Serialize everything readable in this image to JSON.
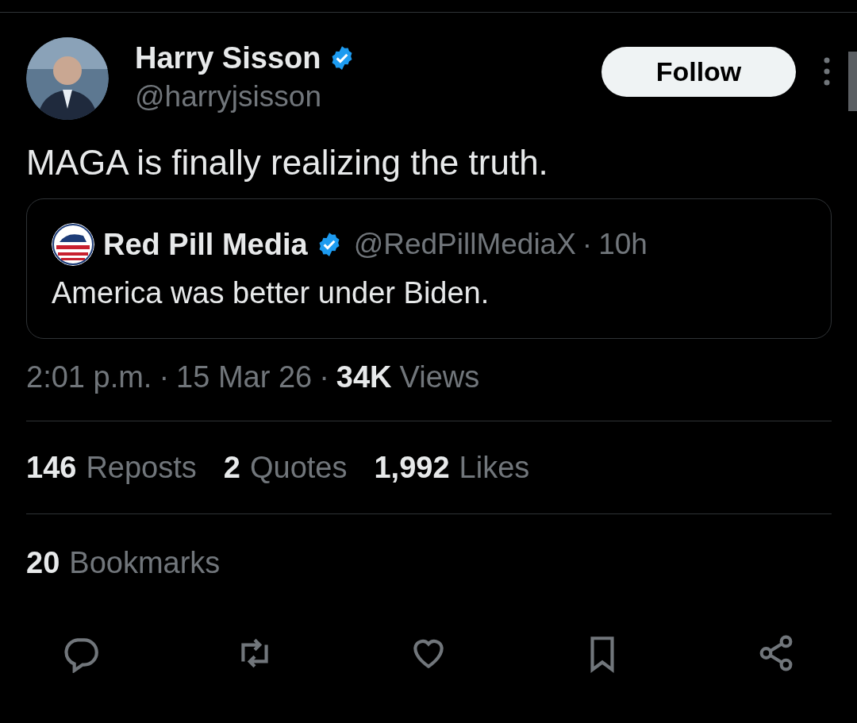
{
  "author": {
    "name": "Harry Sisson",
    "verified": true,
    "handle": "@harryjsisson"
  },
  "follow_button": "Follow",
  "text": "MAGA is finally realizing the truth.",
  "quote": {
    "name": "Red Pill Media",
    "verified": true,
    "handle": "@RedPillMediaX",
    "separator": "·",
    "time": "10h",
    "text": "America was better under Biden."
  },
  "meta": {
    "time": "2:01 p.m.",
    "separator": "·",
    "date": "15 Mar 26",
    "views_count": "34K",
    "views_label": "Views"
  },
  "stats": [
    {
      "count": "146",
      "label": "Reposts"
    },
    {
      "count": "2",
      "label": "Quotes"
    },
    {
      "count": "1,992",
      "label": "Likes"
    }
  ],
  "bookmarks": {
    "count": "20",
    "label": "Bookmarks"
  },
  "actions": [
    {
      "kind": "reply"
    },
    {
      "kind": "repost"
    },
    {
      "kind": "like"
    },
    {
      "kind": "bookmark"
    },
    {
      "kind": "share"
    }
  ]
}
